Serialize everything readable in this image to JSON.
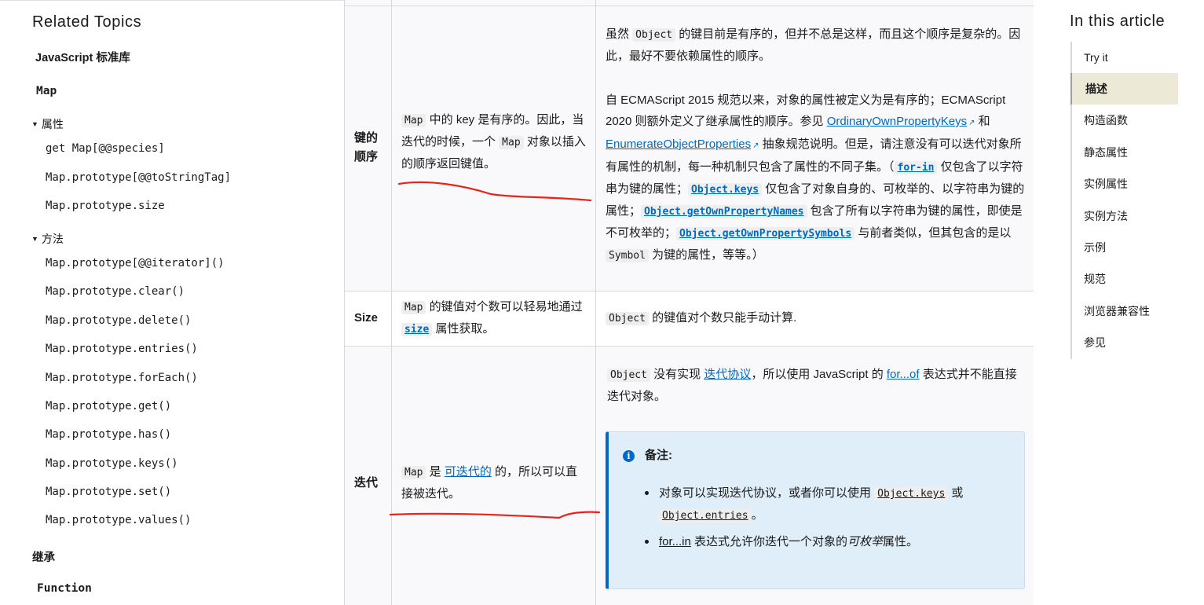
{
  "sidebar": {
    "title": "Related Topics",
    "stdlib_label": "JavaScript 标准库",
    "map_label": "Map",
    "properties_group": "属性",
    "properties": [
      "get Map[@@species]",
      "Map.prototype[@@toStringTag]",
      "Map.prototype.size"
    ],
    "methods_group": "方法",
    "methods": [
      "Map.prototype[@@iterator]()",
      "Map.prototype.clear()",
      "Map.prototype.delete()",
      "Map.prototype.entries()",
      "Map.prototype.forEach()",
      "Map.prototype.get()",
      "Map.prototype.has()",
      "Map.prototype.keys()",
      "Map.prototype.set()",
      "Map.prototype.values()"
    ],
    "inheritance_label": "继承",
    "function_label": "Function"
  },
  "table": {
    "row_order": {
      "header": "键的顺序",
      "map_text": {
        "code": "Map",
        "t1": " 中的 key 是有序的。因此，当迭代的时候，一个 ",
        "code2": "Map",
        "t2": " 对象以插入的顺序返回键值。"
      },
      "obj_p1": {
        "t0": "虽然 ",
        "code": "Object",
        "t1": " 的键目前是有序的，但并不总是这样，而且这个顺序是复杂的。因此，最好不要依赖属性的顺序。"
      },
      "obj_p2": {
        "t0": "自 ECMAScript 2015 规范以来，对象的属性被定义为是有序的；ECMAScript 2020 则额外定义了继承属性的顺序。参见 ",
        "link1": "OrdinaryOwnPropertyKeys",
        "t1": " 和 ",
        "link2": "EnumerateObjectProperties",
        "t2": " 抽象规范说明。但是，请注意没有可以迭代对象所有属性的机制，每一种机制只包含了属性的不同子集。（",
        "code1": "for-in",
        "t3": " 仅包含了以字符串为键的属性；",
        "code2": "Object.keys",
        "t4": " 仅包含了对象自身的、可枚举的、以字符串为键的属性；",
        "code3": "Object.getOwnPropertyNames",
        "t5": " 包含了所有以字符串为键的属性，即使是不可枚举的；",
        "code4": "Object.getOwnPropertySymbols",
        "t6": " 与前者类似，但其包含的是以 ",
        "code5": "Symbol",
        "t7": " 为键的属性，等等。）"
      }
    },
    "row_size": {
      "header": "Size",
      "map_text": {
        "code": "Map",
        "t1": " 的键值对个数可以轻易地通过 ",
        "link": "size",
        "t2": " 属性获取。"
      },
      "obj_text": {
        "code": "Object",
        "t1": " 的键值对个数只能手动计算."
      }
    },
    "row_iter": {
      "header": "迭代",
      "map_text": {
        "code": "Map",
        "t1": " 是 ",
        "link": "可迭代的",
        "t2": " 的，所以可以直接被迭代。"
      },
      "obj_text": {
        "code": "Object",
        "t1": " 没有实现 ",
        "link1": "迭代协议",
        "t2": "，所以使用 JavaScript 的 ",
        "link2": "for...of",
        "t3": " 表达式并不能直接迭代对象。"
      },
      "note": {
        "title": "备注:",
        "item1": {
          "t0": "对象可以实现迭代协议，或者你可以使用 ",
          "code1": "Object.keys",
          "t1": " 或 ",
          "code2": "Object.entries",
          "t2": "。"
        },
        "item2": {
          "link": "for...in",
          "t0": " 表达式允许你迭代一个对象的",
          "em": "可枚举",
          "t1": "属性。"
        }
      }
    }
  },
  "toc": {
    "title": "In this article",
    "items": [
      "Try it",
      "描述",
      "构造函数",
      "静态属性",
      "实例属性",
      "实例方法",
      "示例",
      "规范",
      "浏览器兼容性",
      "参见"
    ],
    "active_index": 1
  },
  "colors": {
    "link": "#0069c2",
    "note_bg": "#dfeef9",
    "toc_active_bg": "#ece9d6",
    "annotation": "#e8231a"
  }
}
